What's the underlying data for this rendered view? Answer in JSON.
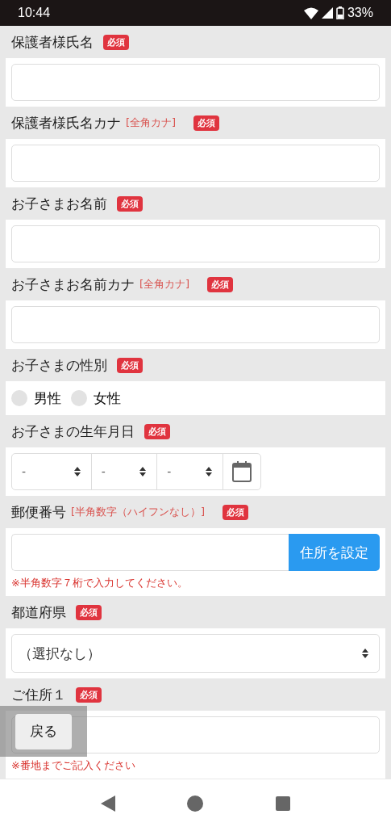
{
  "status_bar": {
    "time": "10:44",
    "battery": "33%"
  },
  "form": [
    {
      "kind": "text",
      "label": "保護者様氏名",
      "required": "必須"
    },
    {
      "kind": "text",
      "label": "保護者様氏名カナ",
      "hint": "[全角カナ]",
      "required": "必須"
    },
    {
      "kind": "text",
      "label": "お子さまお名前",
      "required": "必須"
    },
    {
      "kind": "text",
      "label": "お子さまお名前カナ",
      "hint": "[全角カナ]",
      "required": "必須"
    },
    {
      "kind": "radio",
      "label": "お子さまの性別",
      "required": "必須",
      "options": [
        {
          "label": "男性",
          "selected": false
        },
        {
          "label": "女性",
          "selected": false
        }
      ]
    },
    {
      "kind": "date",
      "label": "お子さまの生年月日",
      "required": "必須",
      "parts": [
        "-",
        "-",
        "-"
      ]
    },
    {
      "kind": "postal",
      "label": "郵便番号",
      "hint": "[半角数字（ハイフンなし）]",
      "required": "必須",
      "button": "住所を設定",
      "note": "※半角数字７桁で入力してください。"
    },
    {
      "kind": "select",
      "label": "都道府県",
      "required": "必須",
      "value": "（選択なし）"
    },
    {
      "kind": "text",
      "label": "ご住所１",
      "required": "必須",
      "note": "※番地までご記入ください"
    }
  ],
  "back_button": "戻る"
}
